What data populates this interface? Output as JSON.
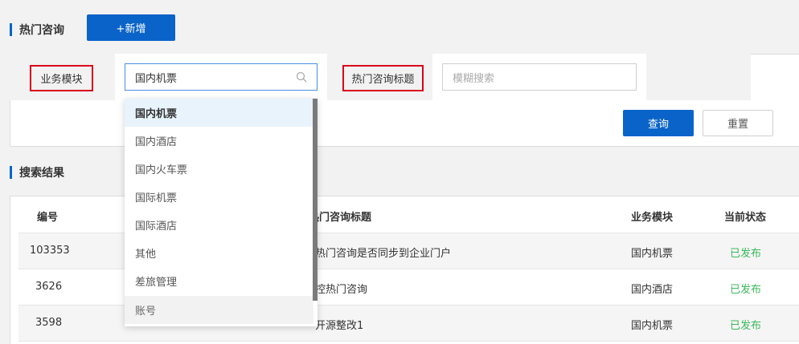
{
  "hot_consult": {
    "title": "热门咨询",
    "add_button": "+新增"
  },
  "filter": {
    "module_label": "业务模块",
    "module_value": "国内机票",
    "title_label": "热门咨询标题",
    "search_placeholder": "模糊搜索",
    "query_button": "查询",
    "reset_button": "重置"
  },
  "dropdown": {
    "options": [
      "国内机票",
      "国内酒店",
      "国内火车票",
      "国际机票",
      "国际酒店",
      "其他",
      "差旅管理",
      "账号"
    ],
    "selected": "国内机票"
  },
  "results": {
    "title": "搜索结果",
    "columns": [
      "编号",
      "热门咨询标题",
      "业务模块",
      "当前状态"
    ],
    "rows": [
      {
        "id": "103353",
        "title": "热门咨询是否同步到企业门户",
        "module": "国内机票",
        "status": "已发布"
      },
      {
        "id": "3626",
        "title": "控热门咨询",
        "module": "国内酒店",
        "status": "已发布"
      },
      {
        "id": "3598",
        "title": "开源整改1",
        "module": "国内机票",
        "status": "已发布"
      }
    ]
  },
  "colors": {
    "primary": "#0a63c9",
    "highlight_border": "#d9001b",
    "status_published": "#3bb85b"
  }
}
